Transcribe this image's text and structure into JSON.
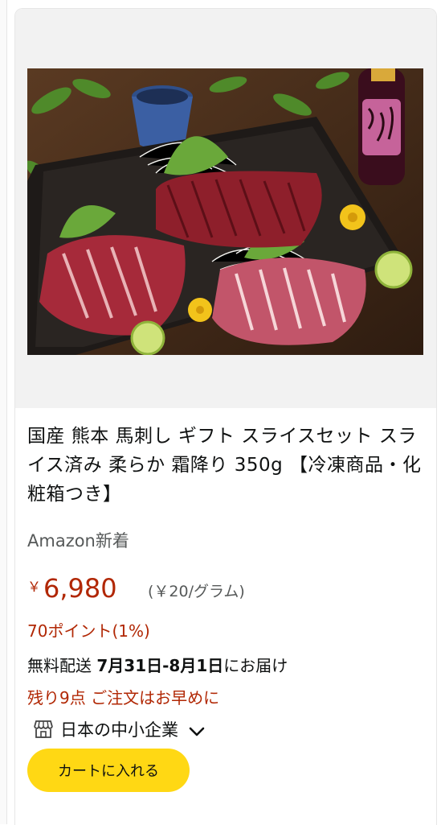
{
  "product": {
    "title": "国産 熊本 馬刺し ギフト スライスセット スライス済み 柔らか 霜降り 350g 【冷凍商品・化粧箱つき】",
    "badge": "Amazon新着",
    "price": {
      "currency": "￥",
      "value": "6,980",
      "unit_price": "(￥20/グラム)"
    },
    "points": "70ポイント(1%)",
    "delivery": {
      "prefix": "無料配送 ",
      "dates": "7月31日-8月1日",
      "suffix": "にお届け"
    },
    "stock": "残り9点 ご注文はお早めに",
    "seller": {
      "label": "日本の中小企業",
      "icon": "storefront-icon"
    },
    "cart_button": "カートに入れる"
  },
  "colors": {
    "price": "#b12704",
    "button": "#ffd814",
    "text": "#0f1111",
    "muted": "#565959"
  }
}
